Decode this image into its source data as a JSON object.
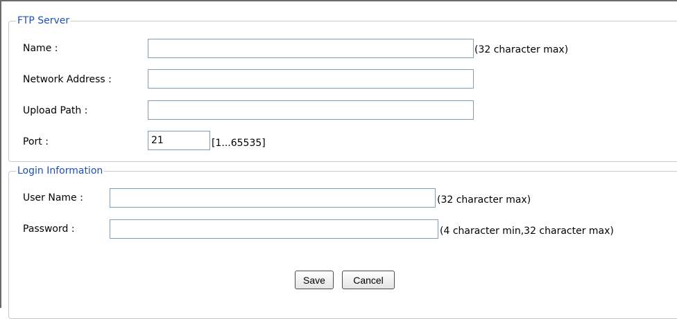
{
  "ftp_server": {
    "legend": "FTP Server",
    "name_label": "Name :",
    "name_value": "",
    "name_hint": "(32 character max)",
    "address_label": "Network Address :",
    "address_value": "",
    "upload_label": "Upload Path :",
    "upload_value": "",
    "port_label": "Port :",
    "port_value": "21",
    "port_hint": "[1...65535]"
  },
  "login": {
    "legend": "Login Information",
    "user_label": "User Name :",
    "user_value": "",
    "user_hint": "(32 character max)",
    "password_label": "Password :",
    "password_value": "",
    "password_hint": "(4 character min,32 character max)"
  },
  "actions": {
    "save_label": "Save",
    "cancel_label": "Cancel"
  }
}
